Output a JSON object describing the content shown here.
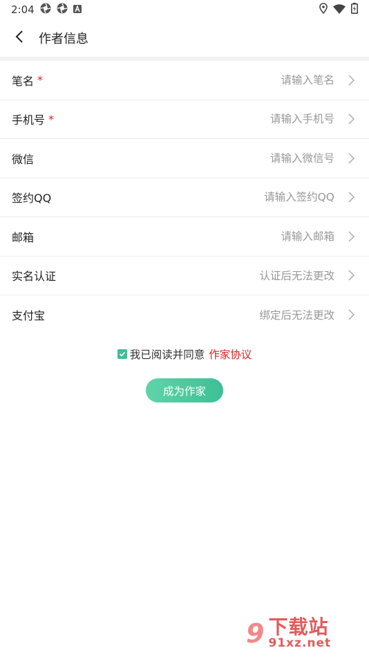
{
  "status_bar": {
    "time": "2:04",
    "left_icons": [
      "aperture-icon",
      "aperture-icon",
      "font-a-icon"
    ],
    "right_icons": [
      "location-icon",
      "wifi-icon",
      "battery-charging-icon"
    ]
  },
  "header": {
    "back_icon": "chevron-left-icon",
    "title": "作者信息"
  },
  "form": {
    "rows": [
      {
        "label": "笔名",
        "required": "*",
        "placeholder": "请输入笔名"
      },
      {
        "label": "手机号",
        "required": "*",
        "placeholder": "请输入手机号"
      },
      {
        "label": "微信",
        "placeholder": "请输入微信号"
      },
      {
        "label": "签约QQ",
        "placeholder": "请输入签约QQ"
      },
      {
        "label": "邮箱",
        "placeholder": "请输入邮箱"
      },
      {
        "label": "实名认证",
        "value": "认证后无法更改"
      },
      {
        "label": "支付宝",
        "value": "绑定后无法更改"
      }
    ]
  },
  "agreement": {
    "checked": true,
    "text": "我已阅读并同意",
    "link": "作家协议"
  },
  "submit": {
    "label": "成为作家"
  },
  "watermark": {
    "logo": "9",
    "text_cn": "下载站",
    "text_en": "91xz.net"
  },
  "colors": {
    "accent_green": "#3dbf96",
    "required_red": "#e02020",
    "placeholder_gray": "#999999"
  }
}
